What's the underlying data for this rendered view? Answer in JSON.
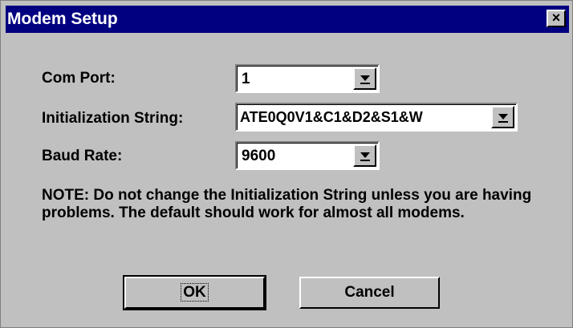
{
  "window": {
    "title": "Modem Setup",
    "close_glyph": "×"
  },
  "fields": {
    "com_port": {
      "label": "Com Port:",
      "value": "1"
    },
    "init_string": {
      "label": "Initialization String:",
      "value": "ATE0Q0V1&C1&D2&S1&W"
    },
    "baud_rate": {
      "label": "Baud Rate:",
      "value": "9600"
    }
  },
  "note": "NOTE: Do not change the Initialization String unless you are having problems.  The default should work for almost all modems.",
  "buttons": {
    "ok": "OK",
    "cancel": "Cancel"
  },
  "colors": {
    "titlebar": "#000080",
    "face": "#c0c0c0"
  }
}
